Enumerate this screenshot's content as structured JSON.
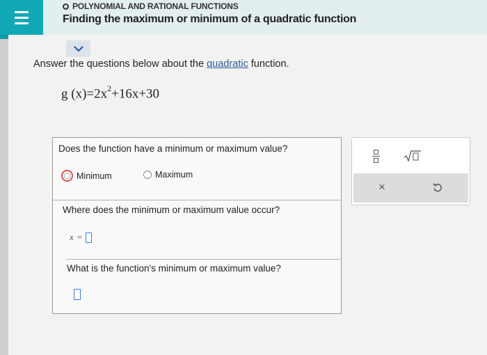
{
  "header": {
    "topic": "POLYNOMIAL AND RATIONAL FUNCTIONS",
    "lesson_title": "Finding the maximum or minimum of a quadratic function"
  },
  "prompt": {
    "before": "Answer the questions below about the ",
    "link": "quadratic",
    "after": " function."
  },
  "equation": {
    "lhs": "g (x)=2x",
    "exponent": "2",
    "rhs": "+16x+30"
  },
  "question1": {
    "text": "Does the function have a minimum or maximum value?",
    "options": [
      {
        "label": "Minimum",
        "selected": true
      },
      {
        "label": "Maximum",
        "selected": false
      }
    ]
  },
  "question2": {
    "text": "Where does the minimum or maximum value occur?",
    "var": "x",
    "eq": "=",
    "value": ""
  },
  "question3": {
    "text": "What is the function's minimum or maximum value?",
    "value": ""
  },
  "palette": {
    "tools": [
      "fraction-icon",
      "square-root-icon",
      "clear-icon",
      "undo-icon"
    ],
    "clear_glyph": "×"
  },
  "colors": {
    "menu_bg": "#11a8b5",
    "selected_radio": "#d9534f",
    "link": "#2a5b9e",
    "input_border": "#3a7bd5"
  }
}
